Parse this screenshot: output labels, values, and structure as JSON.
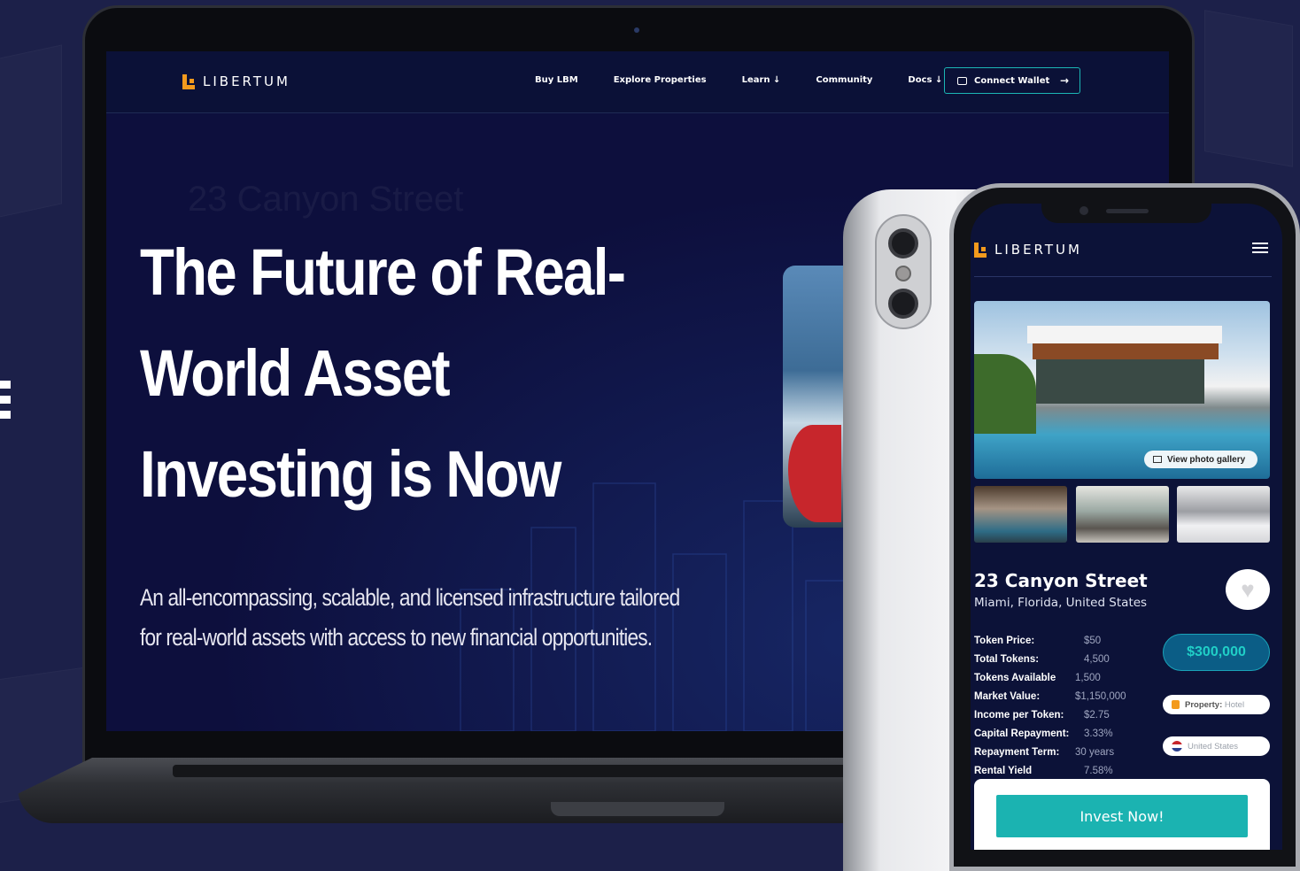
{
  "brand": {
    "name": "LIBERTUM",
    "accent": "#1bb3b1",
    "logo_color": "#f39a1d"
  },
  "desktop": {
    "nav": [
      {
        "label": "Buy LBM"
      },
      {
        "label": "Explore Properties"
      },
      {
        "label": "Learn ↓"
      },
      {
        "label": "Community"
      },
      {
        "label": "Docs ↓"
      }
    ],
    "connect_wallet": {
      "label": "Connect Wallet",
      "icon": "wallet-icon",
      "arrow": "→"
    },
    "ghost_title": "23 Canyon Street",
    "hero_title": "The Future of Real-World Asset Investing is Now",
    "hero_subtitle": "An all-encompassing, scalable, and licensed infrastructure tailored for real-world assets with access to new financial opportunities."
  },
  "mobile": {
    "gallery_button": "View photo gallery",
    "property": {
      "title": "23 Canyon Street",
      "location": "Miami, Florida, United States",
      "price": "$300,000",
      "type_label": "Property:",
      "type_value": "Hotel",
      "country": "United States"
    },
    "details": [
      {
        "key": "Token Price:",
        "value": "$50"
      },
      {
        "key": "Total Tokens:",
        "value": "4,500"
      },
      {
        "key": "Tokens Available",
        "value": "1,500"
      },
      {
        "key": "Market Value:",
        "value": "$1,150,000"
      },
      {
        "key": "Income per Token:",
        "value": "$2.75"
      },
      {
        "key": "Capital Repayment:",
        "value": "3.33%"
      },
      {
        "key": "Repayment Term:",
        "value": "30 years"
      },
      {
        "key": "Rental Yield",
        "value": "7.58%"
      }
    ],
    "invest_button": "Invest Now!"
  }
}
